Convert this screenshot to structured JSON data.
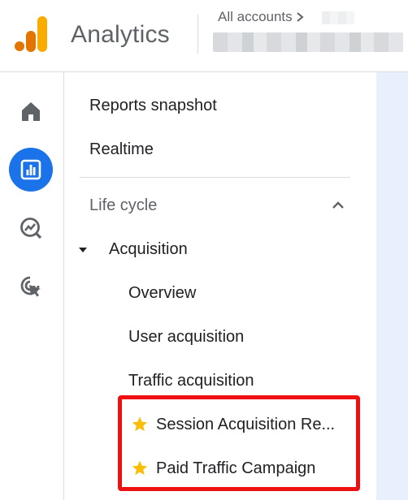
{
  "header": {
    "app_title": "Analytics",
    "breadcrumb_all_accounts": "All accounts",
    "breadcrumb_separator_icon": "chevron-right-icon",
    "logo_icon": "analytics-logo-icon"
  },
  "rail": {
    "items": [
      {
        "icon": "home-icon",
        "active": false
      },
      {
        "icon": "reports-icon",
        "active": true
      },
      {
        "icon": "explore-icon",
        "active": false
      },
      {
        "icon": "advertising-icon",
        "active": false
      }
    ]
  },
  "nav": {
    "reports_snapshot": "Reports snapshot",
    "realtime": "Realtime",
    "section_title": "Life cycle",
    "section_collapse_icon": "chevron-up-icon",
    "acquisition_expand_icon": "caret-down-icon",
    "acquisition": "Acquisition",
    "overview": "Overview",
    "user_acquisition": "User acquisition",
    "traffic_acquisition": "Traffic acquisition",
    "starred": [
      {
        "label": "Session Acquisition Re...",
        "icon": "star-icon"
      },
      {
        "label": "Paid Traffic Campaign",
        "icon": "star-icon"
      }
    ]
  },
  "colors": {
    "accent": "#1a73e8",
    "highlight": "#ee1111",
    "star": "#fbbc04",
    "logo_orange_dark": "#e37400",
    "logo_orange_light": "#f9ab00"
  }
}
